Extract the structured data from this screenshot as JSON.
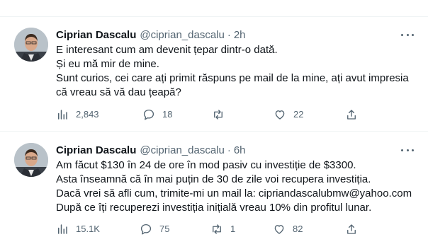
{
  "tweets": [
    {
      "author": {
        "name": "Ciprian Dascalu",
        "handle": "@ciprian_dascalu"
      },
      "separator": "·",
      "time": "2h",
      "lines": [
        "E interesant cum am devenit țepar dintr-o dată.",
        "Și eu mă mir de mine.",
        "Sunt curios, cei care ați primit răspuns pe mail de la mine, ați avut impresia",
        "că vreau să vă dau țeapă?"
      ],
      "stats": {
        "views": "2,843",
        "replies": "18",
        "retweets": "",
        "likes": "22"
      }
    },
    {
      "author": {
        "name": "Ciprian Dascalu",
        "handle": "@ciprian_dascalu"
      },
      "separator": "·",
      "time": "6h",
      "lines": [
        "Am făcut $130 în 24 de ore în mod pasiv cu investiție de $3300.",
        "Asta înseamnă că în mai puțin de 30 de zile voi recupera investiția.",
        "Dacă vrei să afli cum, trimite-mi un mail la: cipriandascalubmw@yahoo.com",
        "După ce îți recuperezi investiția inițială vreau 10% din profitul lunar."
      ],
      "stats": {
        "views": "15.1K",
        "replies": "75",
        "retweets": "1",
        "likes": "82"
      }
    }
  ],
  "icons": {
    "views": "bar-chart-icon",
    "reply": "speech-bubble-icon",
    "retweet": "retweet-icon",
    "like": "heart-icon",
    "share": "share-upload-icon",
    "more": "more-dots-icon"
  },
  "colors": {
    "text": "#0f1419",
    "secondary": "#536471",
    "divider": "#eff3f4"
  }
}
